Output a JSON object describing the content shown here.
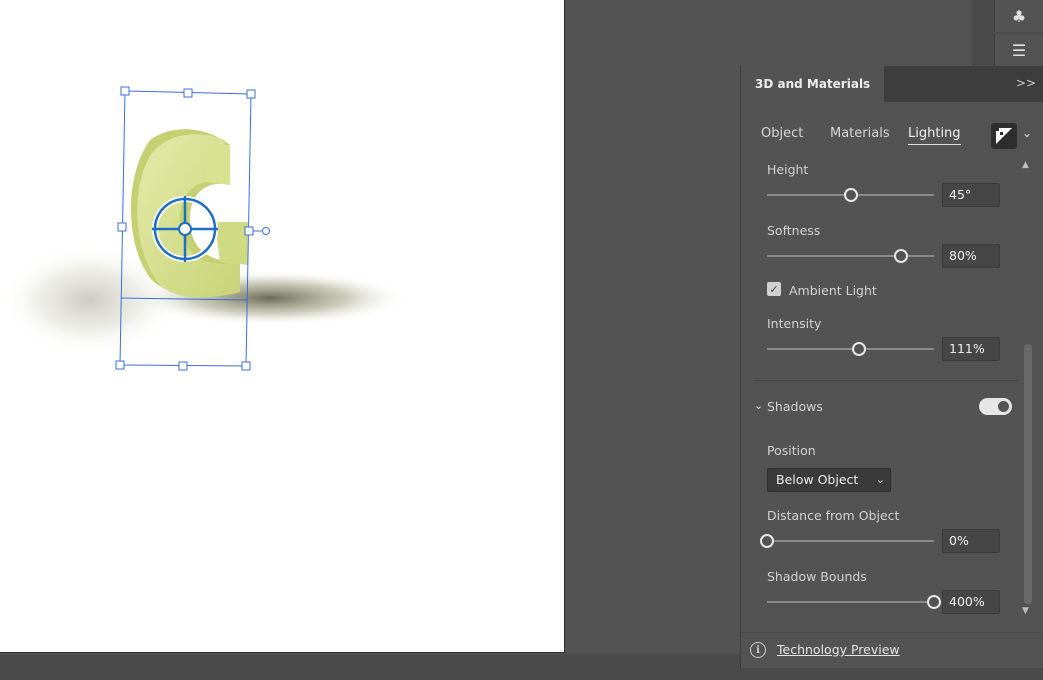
{
  "panel": {
    "title": "3D and Materials",
    "collapse_icon": "double-chevron-right-icon",
    "tabs": [
      {
        "label": "Object"
      },
      {
        "label": "Materials"
      },
      {
        "label": "Lighting"
      }
    ],
    "active_tab": "Lighting",
    "preset_icon": "lighting-preset-icon",
    "lighting": {
      "height": {
        "label": "Height",
        "value": "45°",
        "level": 0.5
      },
      "softness": {
        "label": "Softness",
        "value": "80%",
        "level": 0.8
      },
      "ambient_light": {
        "label": "Ambient Light",
        "checked": true
      },
      "intensity": {
        "label": "Intensity",
        "value": "111%",
        "level": 0.55
      }
    },
    "shadows": {
      "label": "Shadows",
      "enabled": true,
      "position_label": "Position",
      "position_value": "Below Object",
      "distance": {
        "label": "Distance from Object",
        "value": "0%",
        "level": 0.0
      },
      "bounds": {
        "label": "Shadow Bounds",
        "value": "400%",
        "level": 1.0
      }
    },
    "footer": {
      "link": "Technology Preview"
    }
  },
  "colors": {
    "object_fill": "#d4e08a",
    "selection": "#3b6fd4",
    "panel_bg": "#535353"
  }
}
